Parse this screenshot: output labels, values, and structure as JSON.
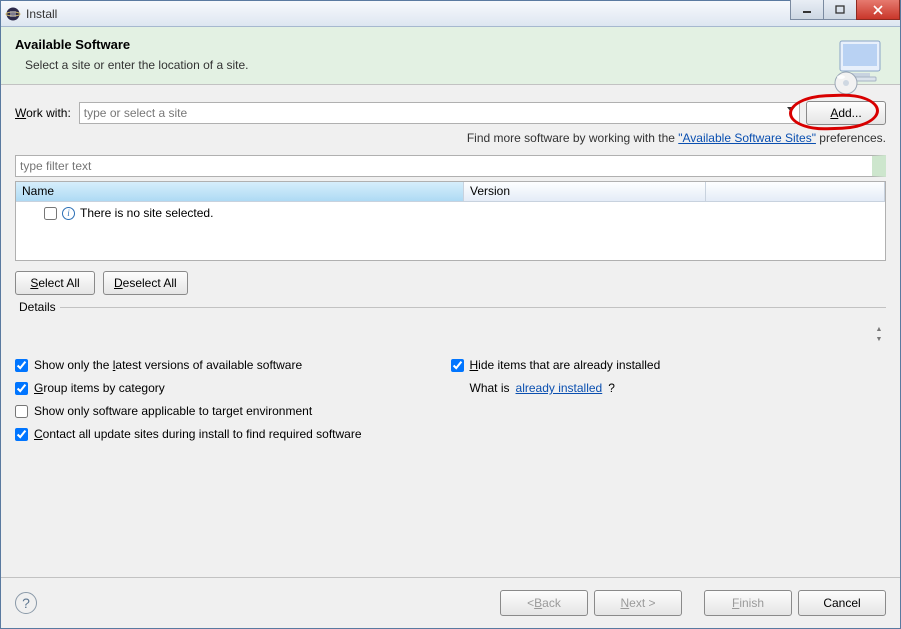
{
  "window": {
    "title": "Install"
  },
  "banner": {
    "heading": "Available Software",
    "sub": "Select a site or enter the location of a site."
  },
  "workwith": {
    "label_pre": "W",
    "label_post": "ork with:",
    "placeholder": "type or select a site",
    "add_pre": "A",
    "add_post": "dd..."
  },
  "hint": {
    "pre": "Find more software by working with the ",
    "link": "\"Available Software Sites\"",
    "post": " preferences."
  },
  "filter": {
    "placeholder": "type filter text"
  },
  "table": {
    "cols": {
      "name": "Name",
      "version": "Version"
    },
    "empty_msg": "There is no site selected."
  },
  "sel": {
    "select_all_pre": "S",
    "select_all_post": "elect All",
    "deselect_all_pre": "D",
    "deselect_all_post": "eselect All"
  },
  "details": {
    "label": "Details"
  },
  "options": {
    "latest": {
      "pre": "Show only the ",
      "u": "l",
      "post": "atest versions of available software",
      "checked": true
    },
    "group": {
      "pre": "",
      "u": "G",
      "post": "roup items by category",
      "checked": true
    },
    "applicable": {
      "text": "Show only software applicable to target environment",
      "checked": false
    },
    "contact": {
      "pre": "",
      "u": "C",
      "post": "ontact all update sites during install to find required software",
      "checked": true
    },
    "hide": {
      "pre": "",
      "u": "H",
      "post": "ide items that are already installed",
      "checked": true
    },
    "whatis": {
      "pre": "What is ",
      "link": "already installed",
      "post": "?"
    }
  },
  "buttons": {
    "back": {
      "lt": "< ",
      "u": "B",
      "post": "ack"
    },
    "next": {
      "u": "N",
      "post": "ext >"
    },
    "finish": {
      "u": "F",
      "post": "inish"
    },
    "cancel": "Cancel"
  }
}
